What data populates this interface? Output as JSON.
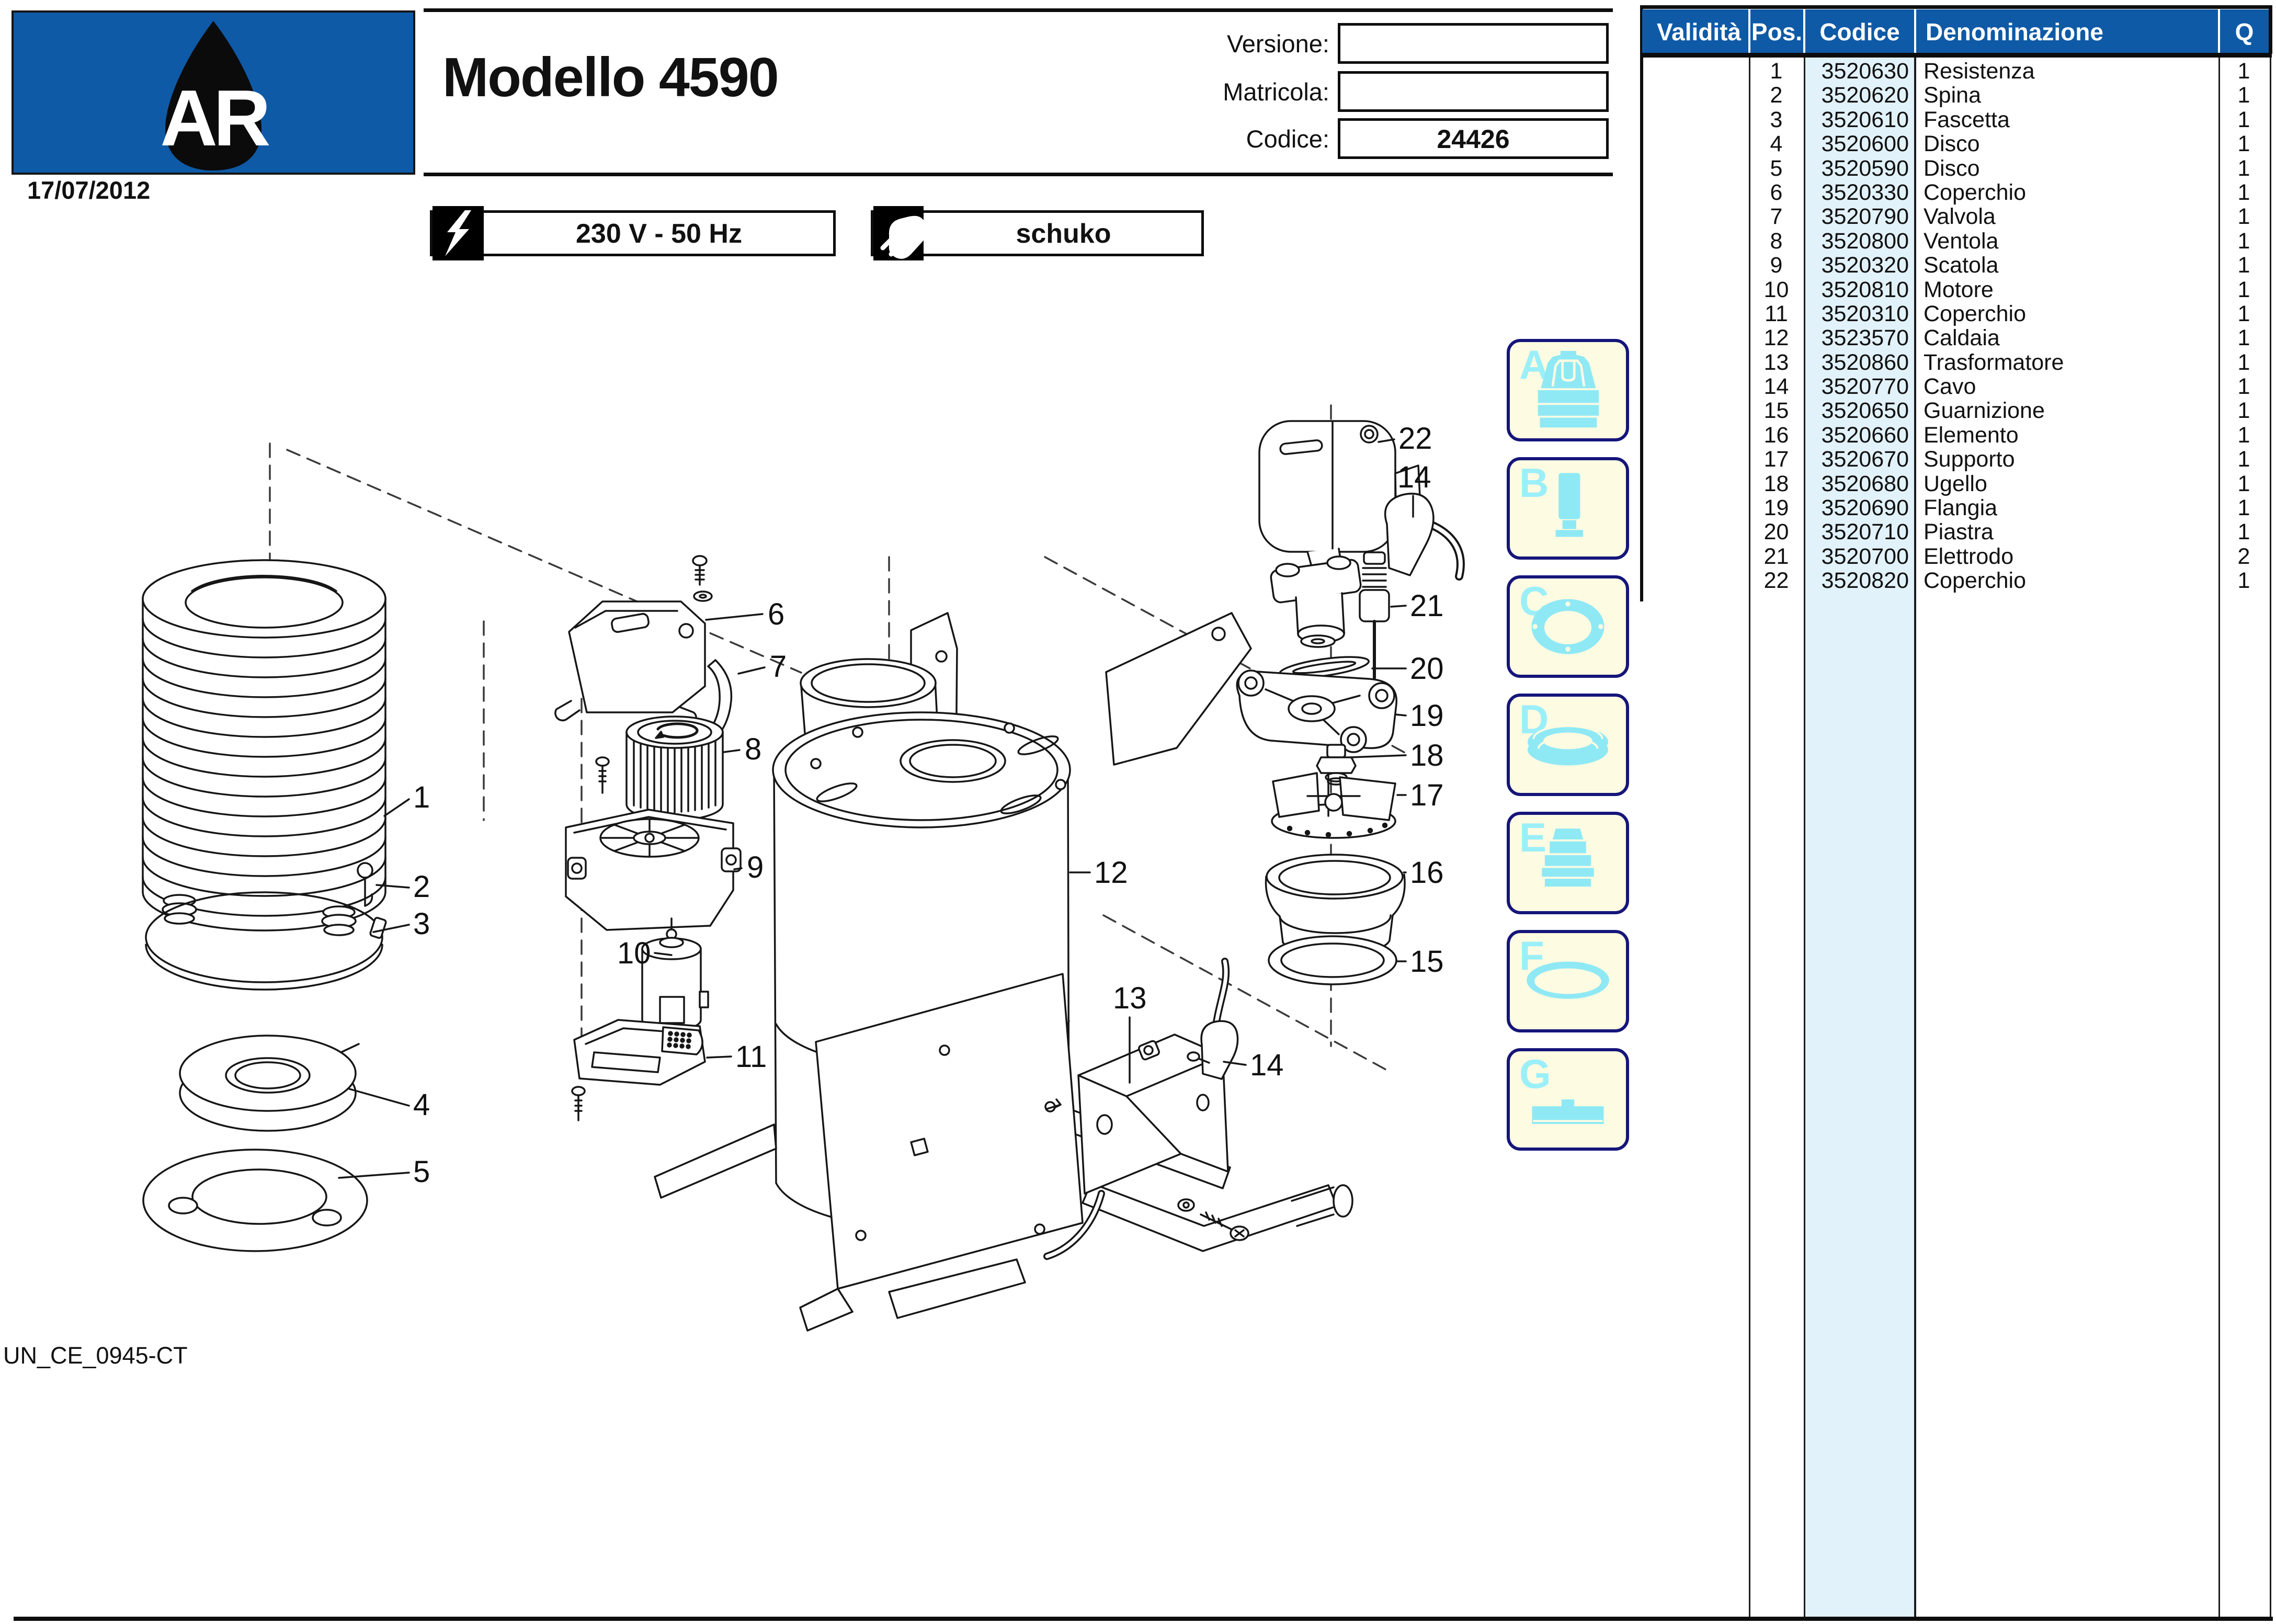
{
  "page": {
    "date": "17/07/2012",
    "doc_code": "UN_CE_0945-CT"
  },
  "logo": {
    "letters": "AR"
  },
  "header": {
    "title": "Modello 4590",
    "fields": [
      {
        "label": "Versione:",
        "value": ""
      },
      {
        "label": "Matricola:",
        "value": ""
      },
      {
        "label": "Codice:",
        "value": "24426"
      }
    ],
    "badges": [
      {
        "icon": "lightning-icon",
        "label": "230 V - 50 Hz"
      },
      {
        "icon": "plug-icon",
        "label": "schuko"
      }
    ]
  },
  "parts_table": {
    "columns": {
      "validita": "Validità",
      "pos": "Pos.",
      "codice": "Codice",
      "denominazione": "Denominazione",
      "q": "Q"
    },
    "rows": [
      {
        "pos": "1",
        "codice": "3520630",
        "denominazione": "Resistenza",
        "q": "1"
      },
      {
        "pos": "2",
        "codice": "3520620",
        "denominazione": "Spina",
        "q": "1"
      },
      {
        "pos": "3",
        "codice": "3520610",
        "denominazione": "Fascetta",
        "q": "1"
      },
      {
        "pos": "4",
        "codice": "3520600",
        "denominazione": "Disco",
        "q": "1"
      },
      {
        "pos": "5",
        "codice": "3520590",
        "denominazione": "Disco",
        "q": "1"
      },
      {
        "pos": "6",
        "codice": "3520330",
        "denominazione": "Coperchio",
        "q": "1"
      },
      {
        "pos": "7",
        "codice": "3520790",
        "denominazione": "Valvola",
        "q": "1"
      },
      {
        "pos": "8",
        "codice": "3520800",
        "denominazione": "Ventola",
        "q": "1"
      },
      {
        "pos": "9",
        "codice": "3520320",
        "denominazione": "Scatola",
        "q": "1"
      },
      {
        "pos": "10",
        "codice": "3520810",
        "denominazione": "Motore",
        "q": "1"
      },
      {
        "pos": "11",
        "codice": "3520310",
        "denominazione": "Coperchio",
        "q": "1"
      },
      {
        "pos": "12",
        "codice": "3523570",
        "denominazione": "Caldaia",
        "q": "1"
      },
      {
        "pos": "13",
        "codice": "3520860",
        "denominazione": "Trasformatore",
        "q": "1"
      },
      {
        "pos": "14",
        "codice": "3520770",
        "denominazione": "Cavo",
        "q": "1"
      },
      {
        "pos": "15",
        "codice": "3520650",
        "denominazione": "Guarnizione",
        "q": "1"
      },
      {
        "pos": "16",
        "codice": "3520660",
        "denominazione": "Elemento",
        "q": "1"
      },
      {
        "pos": "17",
        "codice": "3520670",
        "denominazione": "Supporto",
        "q": "1"
      },
      {
        "pos": "18",
        "codice": "3520680",
        "denominazione": "Ugello",
        "q": "1"
      },
      {
        "pos": "19",
        "codice": "3520690",
        "denominazione": "Flangia",
        "q": "1"
      },
      {
        "pos": "20",
        "codice": "3520710",
        "denominazione": "Piastra",
        "q": "1"
      },
      {
        "pos": "21",
        "codice": "3520700",
        "denominazione": "Elettrodo",
        "q": "2"
      },
      {
        "pos": "22",
        "codice": "3520820",
        "denominazione": "Coperchio",
        "q": "1"
      }
    ]
  },
  "variant_boxes": [
    {
      "letter": "A",
      "icon": "connector-cap-icon"
    },
    {
      "letter": "B",
      "icon": "cylinder-plug-icon"
    },
    {
      "letter": "C",
      "icon": "flange-gasket-icon"
    },
    {
      "letter": "D",
      "icon": "seal-ring-icon"
    },
    {
      "letter": "E",
      "icon": "bellows-adapter-icon"
    },
    {
      "letter": "F",
      "icon": "o-ring-icon"
    },
    {
      "letter": "G",
      "icon": "plate-bar-icon"
    }
  ],
  "diagram": {
    "callouts": [
      {
        "n": "1"
      },
      {
        "n": "2"
      },
      {
        "n": "3"
      },
      {
        "n": "4"
      },
      {
        "n": "5"
      },
      {
        "n": "6"
      },
      {
        "n": "7"
      },
      {
        "n": "8"
      },
      {
        "n": "9"
      },
      {
        "n": "10"
      },
      {
        "n": "11"
      },
      {
        "n": "12"
      },
      {
        "n": "13"
      },
      {
        "n": "14"
      },
      {
        "n": "22"
      },
      {
        "n": "14"
      },
      {
        "n": "21"
      },
      {
        "n": "20"
      },
      {
        "n": "19"
      },
      {
        "n": "18"
      },
      {
        "n": "17"
      },
      {
        "n": "16"
      },
      {
        "n": "15"
      }
    ]
  },
  "colors": {
    "brand_blue": "#0F5AA6",
    "table_codice_bg": "#E2F2FB",
    "panel_bg": "#FDFBE2",
    "panel_border": "#15157A",
    "icon_cyan": "#8FE9F5",
    "letter_cyan": "#9BEFF9"
  }
}
